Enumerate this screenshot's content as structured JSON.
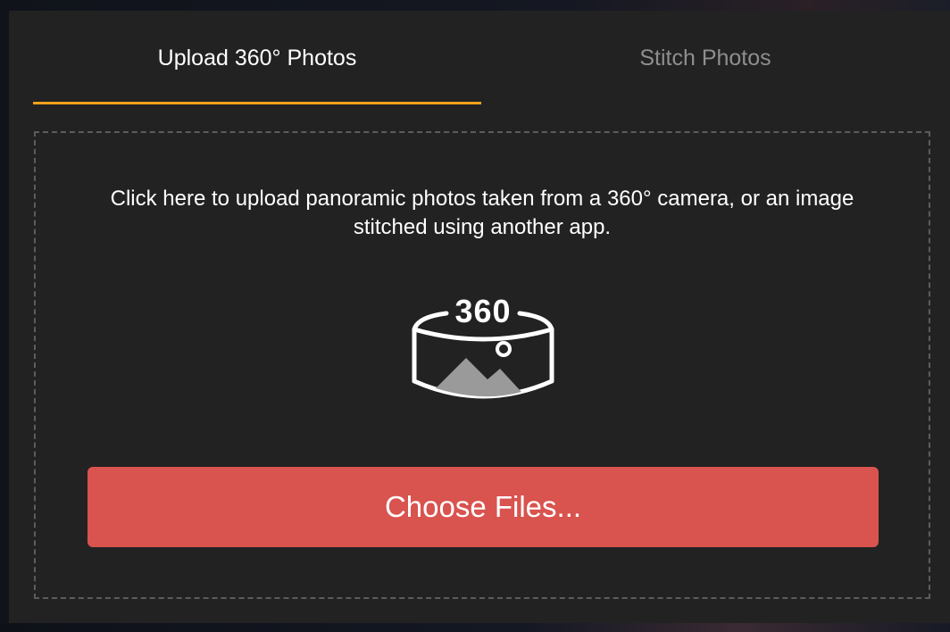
{
  "tabs": [
    {
      "label": "Upload 360° Photos",
      "active": true
    },
    {
      "label": "Stitch Photos",
      "active": false
    }
  ],
  "dropzone": {
    "instructions": "Click here to upload panoramic photos taken from a 360° camera, or an image stitched using another app.",
    "icon": "panorama-360-icon",
    "icon_text": "360"
  },
  "choose_button": {
    "label": "Choose Files..."
  },
  "colors": {
    "panel_bg": "#222222",
    "active_tab_text": "#ffffff",
    "inactive_tab_text": "#8e8e8e",
    "tab_underline": "#f0a11c",
    "button_bg": "#d9534f",
    "dashed_border": "#5c5c5c"
  }
}
